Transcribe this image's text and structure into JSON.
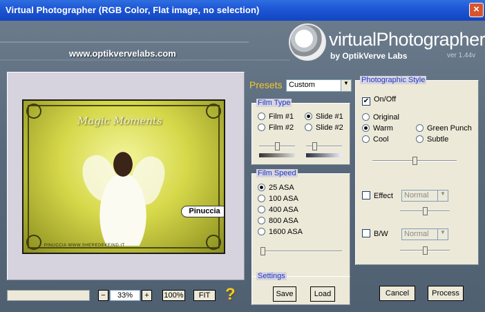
{
  "window": {
    "title": "Virtual Photographer (RGB Color, Flat image, no selection)",
    "close_symbol": "×"
  },
  "header": {
    "url": "www.optikvervelabs.com",
    "logo_title": "virtualPhotographer",
    "logo_subtitle": "by OptikVerve Labs",
    "version": "ver 1.44v"
  },
  "preview": {
    "image_title": "Magic Moments",
    "name_badge": "Pinuccia",
    "footer_text": "PINUCCIA WWW.SHEREDEKEIND.IT"
  },
  "zoom": {
    "minus": "−",
    "value": "33%",
    "plus": "+",
    "hundred": "100%",
    "fit": "FIT",
    "help": "?"
  },
  "presets": {
    "label": "Presets",
    "value": "Custom"
  },
  "film_type": {
    "title": "Film Type",
    "options": [
      {
        "label": "Film #1",
        "selected": false
      },
      {
        "label": "Slide #1",
        "selected": true
      },
      {
        "label": "Film #2",
        "selected": false
      },
      {
        "label": "Slide #2",
        "selected": false
      }
    ],
    "slider1": 0.5,
    "slider2": 0.2
  },
  "film_speed": {
    "title": "Film Speed",
    "options": [
      {
        "label": "25 ASA",
        "selected": true
      },
      {
        "label": "100 ASA",
        "selected": false
      },
      {
        "label": "400 ASA",
        "selected": false
      },
      {
        "label": "800 ASA",
        "selected": false
      },
      {
        "label": "1600 ASA",
        "selected": false
      }
    ],
    "slider": 0.0
  },
  "settings": {
    "title": "Settings",
    "save": "Save",
    "load": "Load"
  },
  "photo_style": {
    "title": "Photographic Style",
    "onoff_label": "On/Off",
    "onoff_checked": true,
    "styles": [
      {
        "label": "Original",
        "selected": false
      },
      {
        "label": "Warm",
        "selected": true
      },
      {
        "label": "Green Punch",
        "selected": false
      },
      {
        "label": "Cool",
        "selected": false
      },
      {
        "label": "Subtle",
        "selected": false
      }
    ],
    "style_slider": 0.5,
    "effect_label": "Effect",
    "effect_checked": false,
    "effect_mode": "Normal",
    "effect_slider": 0.5,
    "bw_label": "B/W",
    "bw_checked": false,
    "bw_mode": "Normal",
    "bw_slider": 0.5
  },
  "actions": {
    "cancel": "Cancel",
    "process": "Process"
  },
  "colors": {
    "title_bar": "#1f58d6",
    "presets_label": "#f5c826",
    "group_title": "#1a3cbf",
    "help_icon": "#f3cc2a"
  }
}
